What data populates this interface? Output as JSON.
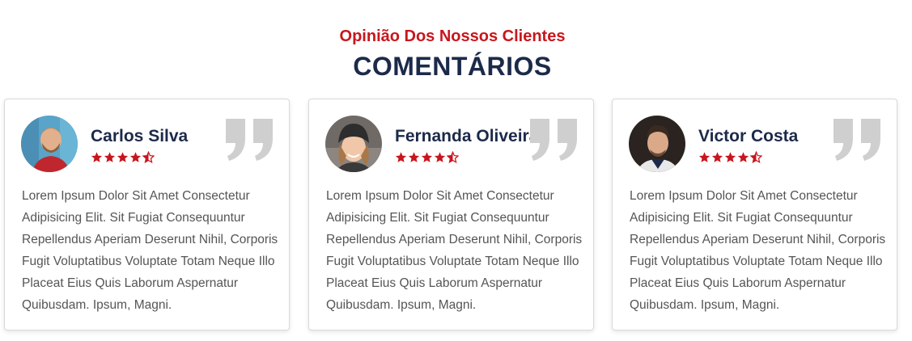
{
  "header": {
    "subtitle": "Opinião Dos Nossos Clientes",
    "title": "COMENTÁRIOS"
  },
  "colors": {
    "accent": "#c8161d",
    "heading": "#1c2a4a",
    "text": "#555555",
    "quote_icon": "#cfcfcf"
  },
  "testimonials": [
    {
      "name": "Carlos Silva",
      "rating": 4.5,
      "rating_max": 5,
      "avatar_icon": "avatar-photo-man-beard",
      "quote_icon": "quote-icon",
      "text": "Lorem Ipsum Dolor Sit Amet Consectetur Adipisicing Elit. Sit Fugiat Consequuntur Repellendus Aperiam Deserunt Nihil, Corporis Fugit Voluptatibus Voluptate Totam Neque Illo Placeat Eius Quis Laborum Aspernatur Quibusdam. Ipsum, Magni."
    },
    {
      "name": "Fernanda Oliveira",
      "rating": 4.5,
      "rating_max": 5,
      "avatar_icon": "avatar-photo-woman-beanie",
      "quote_icon": "quote-icon",
      "text": "Lorem Ipsum Dolor Sit Amet Consectetur Adipisicing Elit. Sit Fugiat Consequuntur Repellendus Aperiam Deserunt Nihil, Corporis Fugit Voluptatibus Voluptate Totam Neque Illo Placeat Eius Quis Laborum Aspernatur Quibusdam. Ipsum, Magni."
    },
    {
      "name": "Victor Costa",
      "rating": 4.5,
      "rating_max": 5,
      "avatar_icon": "avatar-photo-man-dark",
      "quote_icon": "quote-icon",
      "text": "Lorem Ipsum Dolor Sit Amet Consectetur Adipisicing Elit. Sit Fugiat Consequuntur Repellendus Aperiam Deserunt Nihil, Corporis Fugit Voluptatibus Voluptate Totam Neque Illo Placeat Eius Quis Laborum Aspernatur Quibusdam. Ipsum, Magni."
    }
  ]
}
